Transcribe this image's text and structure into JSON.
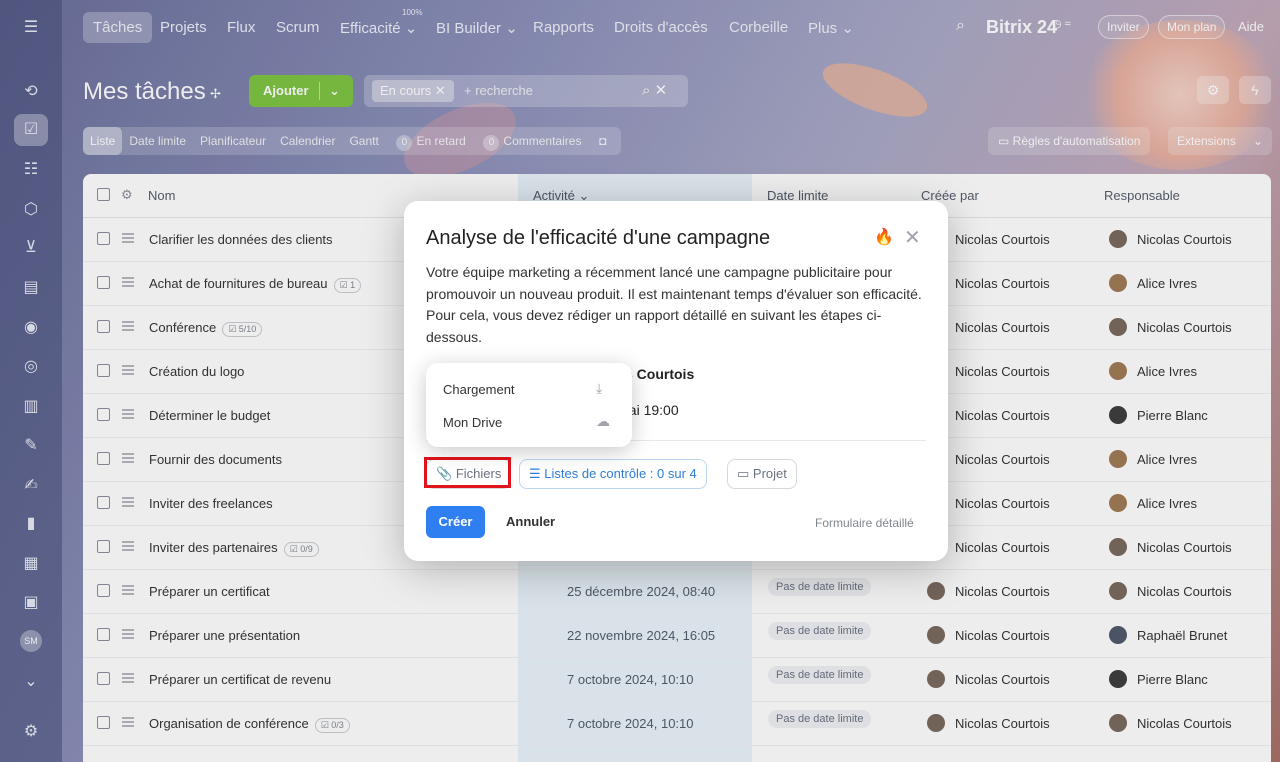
{
  "topnav": {
    "items": [
      "Tâches",
      "Projets",
      "Flux",
      "Scrum",
      "Efficacité ⌄",
      "BI Builder ⌄",
      "Rapports",
      "Droits d'accès",
      "Corbeille",
      "Plus ⌄"
    ],
    "efficiency_small": "100%",
    "brand": "Bitrix 24",
    "invite": "Inviter",
    "plan": "Mon plan",
    "help": "Aide"
  },
  "header": {
    "title": "Mes tâches",
    "add_label": "Ajouter",
    "filter_chip": "En cours",
    "search_placeholder": "+ recherche"
  },
  "views": {
    "items": [
      "Liste",
      "Date limite",
      "Planificateur",
      "Calendrier",
      "Gantt"
    ],
    "overdue_count": "0",
    "overdue_label": "En retard",
    "comments_count": "0",
    "comments_label": "Commentaires",
    "rules": "Règles d'automatisation",
    "extensions": "Extensions"
  },
  "table": {
    "columns": [
      "Nom",
      "Activité ⌄",
      "Date limite",
      "Créée par",
      "Responsable"
    ],
    "rows": [
      {
        "name": "Clarifier les données des clients",
        "badge": "",
        "activity": "",
        "deadline": "",
        "creator": "Nicolas Courtois",
        "responsible": "Nicolas Courtois"
      },
      {
        "name": "Achat de fournitures de bureau",
        "badge": "1",
        "activity": "",
        "deadline": "",
        "creator": "Nicolas Courtois",
        "responsible": "Alice Ivres"
      },
      {
        "name": "Conférence",
        "badge": "5/10",
        "activity": "",
        "deadline": "",
        "creator": "Nicolas Courtois",
        "responsible": "Nicolas Courtois"
      },
      {
        "name": "Création du logo",
        "badge": "",
        "activity": "",
        "deadline": "",
        "creator": "Nicolas Courtois",
        "responsible": "Alice Ivres"
      },
      {
        "name": "Déterminer le budget",
        "badge": "",
        "activity": "",
        "deadline": "",
        "creator": "Nicolas Courtois",
        "responsible": "Pierre Blanc"
      },
      {
        "name": "Fournir des documents",
        "badge": "",
        "activity": "",
        "deadline": "",
        "creator": "Nicolas Courtois",
        "responsible": "Alice Ivres"
      },
      {
        "name": "Inviter des freelances",
        "badge": "",
        "activity": "",
        "deadline": "",
        "creator": "Nicolas Courtois",
        "responsible": "Alice Ivres"
      },
      {
        "name": "Inviter des partenaires",
        "badge": "0/9",
        "activity": "",
        "deadline": "",
        "creator": "Nicolas Courtois",
        "responsible": "Nicolas Courtois"
      },
      {
        "name": "Préparer un certificat",
        "badge": "",
        "activity": "25 décembre 2024, 08:40",
        "deadline": "Pas de date limite",
        "creator": "Nicolas Courtois",
        "responsible": "Nicolas Courtois"
      },
      {
        "name": "Préparer une présentation",
        "badge": "",
        "activity": "22 novembre 2024, 16:05",
        "deadline": "Pas de date limite",
        "creator": "Nicolas Courtois",
        "responsible": "Raphaël Brunet"
      },
      {
        "name": "Préparer un certificat de revenu",
        "badge": "",
        "activity": "7 octobre 2024, 10:10",
        "deadline": "Pas de date limite",
        "creator": "Nicolas Courtois",
        "responsible": "Pierre Blanc"
      },
      {
        "name": "Organisation de conférence",
        "badge": "0/3",
        "activity": "7 octobre 2024, 10:10",
        "deadline": "Pas de date limite",
        "creator": "Nicolas Courtois",
        "responsible": "Nicolas Courtois"
      }
    ]
  },
  "modal": {
    "title": "Analyse de l'efficacité d'une campagne",
    "description": "Votre équipe marketing a récemment lancé une campagne publicitaire pour promouvoir un nouveau produit. Il est maintenant temps d'évaluer son efficacité. Pour cela, vous devez rédiger un rapport détaillé en suivant les étapes ci-dessous.",
    "meta_person": "s Courtois",
    "meta_date": "nai 19:00",
    "files_label": "Fichiers",
    "checklist_label": "Listes de contrôle : 0 sur 4",
    "project_label": "Projet",
    "create_label": "Créer",
    "cancel_label": "Annuler",
    "detailed_label": "Formulaire détaillé"
  },
  "popup": {
    "items": [
      "Chargement",
      "Mon Drive"
    ]
  },
  "sidebar": {
    "avatar_initials": "SM"
  }
}
